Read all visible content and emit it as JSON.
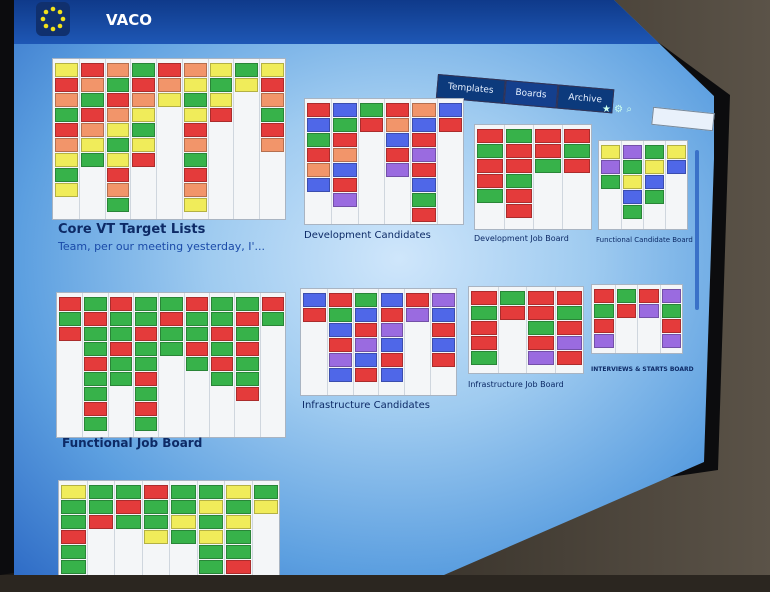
{
  "app": {
    "title": "VACO"
  },
  "tabs": [
    {
      "label": "Templates",
      "active": false
    },
    {
      "label": "Boards",
      "active": true
    },
    {
      "label": "Archive",
      "active": false
    }
  ],
  "search": {
    "placeholder": ""
  },
  "boards": [
    {
      "title": "Core VT Target Lists",
      "subtitle": "Team, per our meeting yesterday, I'..."
    },
    {
      "title": "Development Candidates"
    },
    {
      "title": "Development Job Board"
    },
    {
      "title": "Functional Candidate Board"
    },
    {
      "title": "Functional Job Board"
    },
    {
      "title": "Infrastructure Candidates"
    },
    {
      "title": "Infrastructure Job Board"
    },
    {
      "title": "INTERVIEWS & STARTS BOARD"
    },
    {
      "title": ""
    }
  ],
  "colors": {
    "topbar": "#0f3a8a",
    "note_yellow": "#f0ec5a",
    "note_red": "#e43b3b",
    "note_green": "#37b24a",
    "note_blue": "#4f67e8",
    "note_orange": "#f2956a",
    "note_purple": "#9a6be0"
  }
}
